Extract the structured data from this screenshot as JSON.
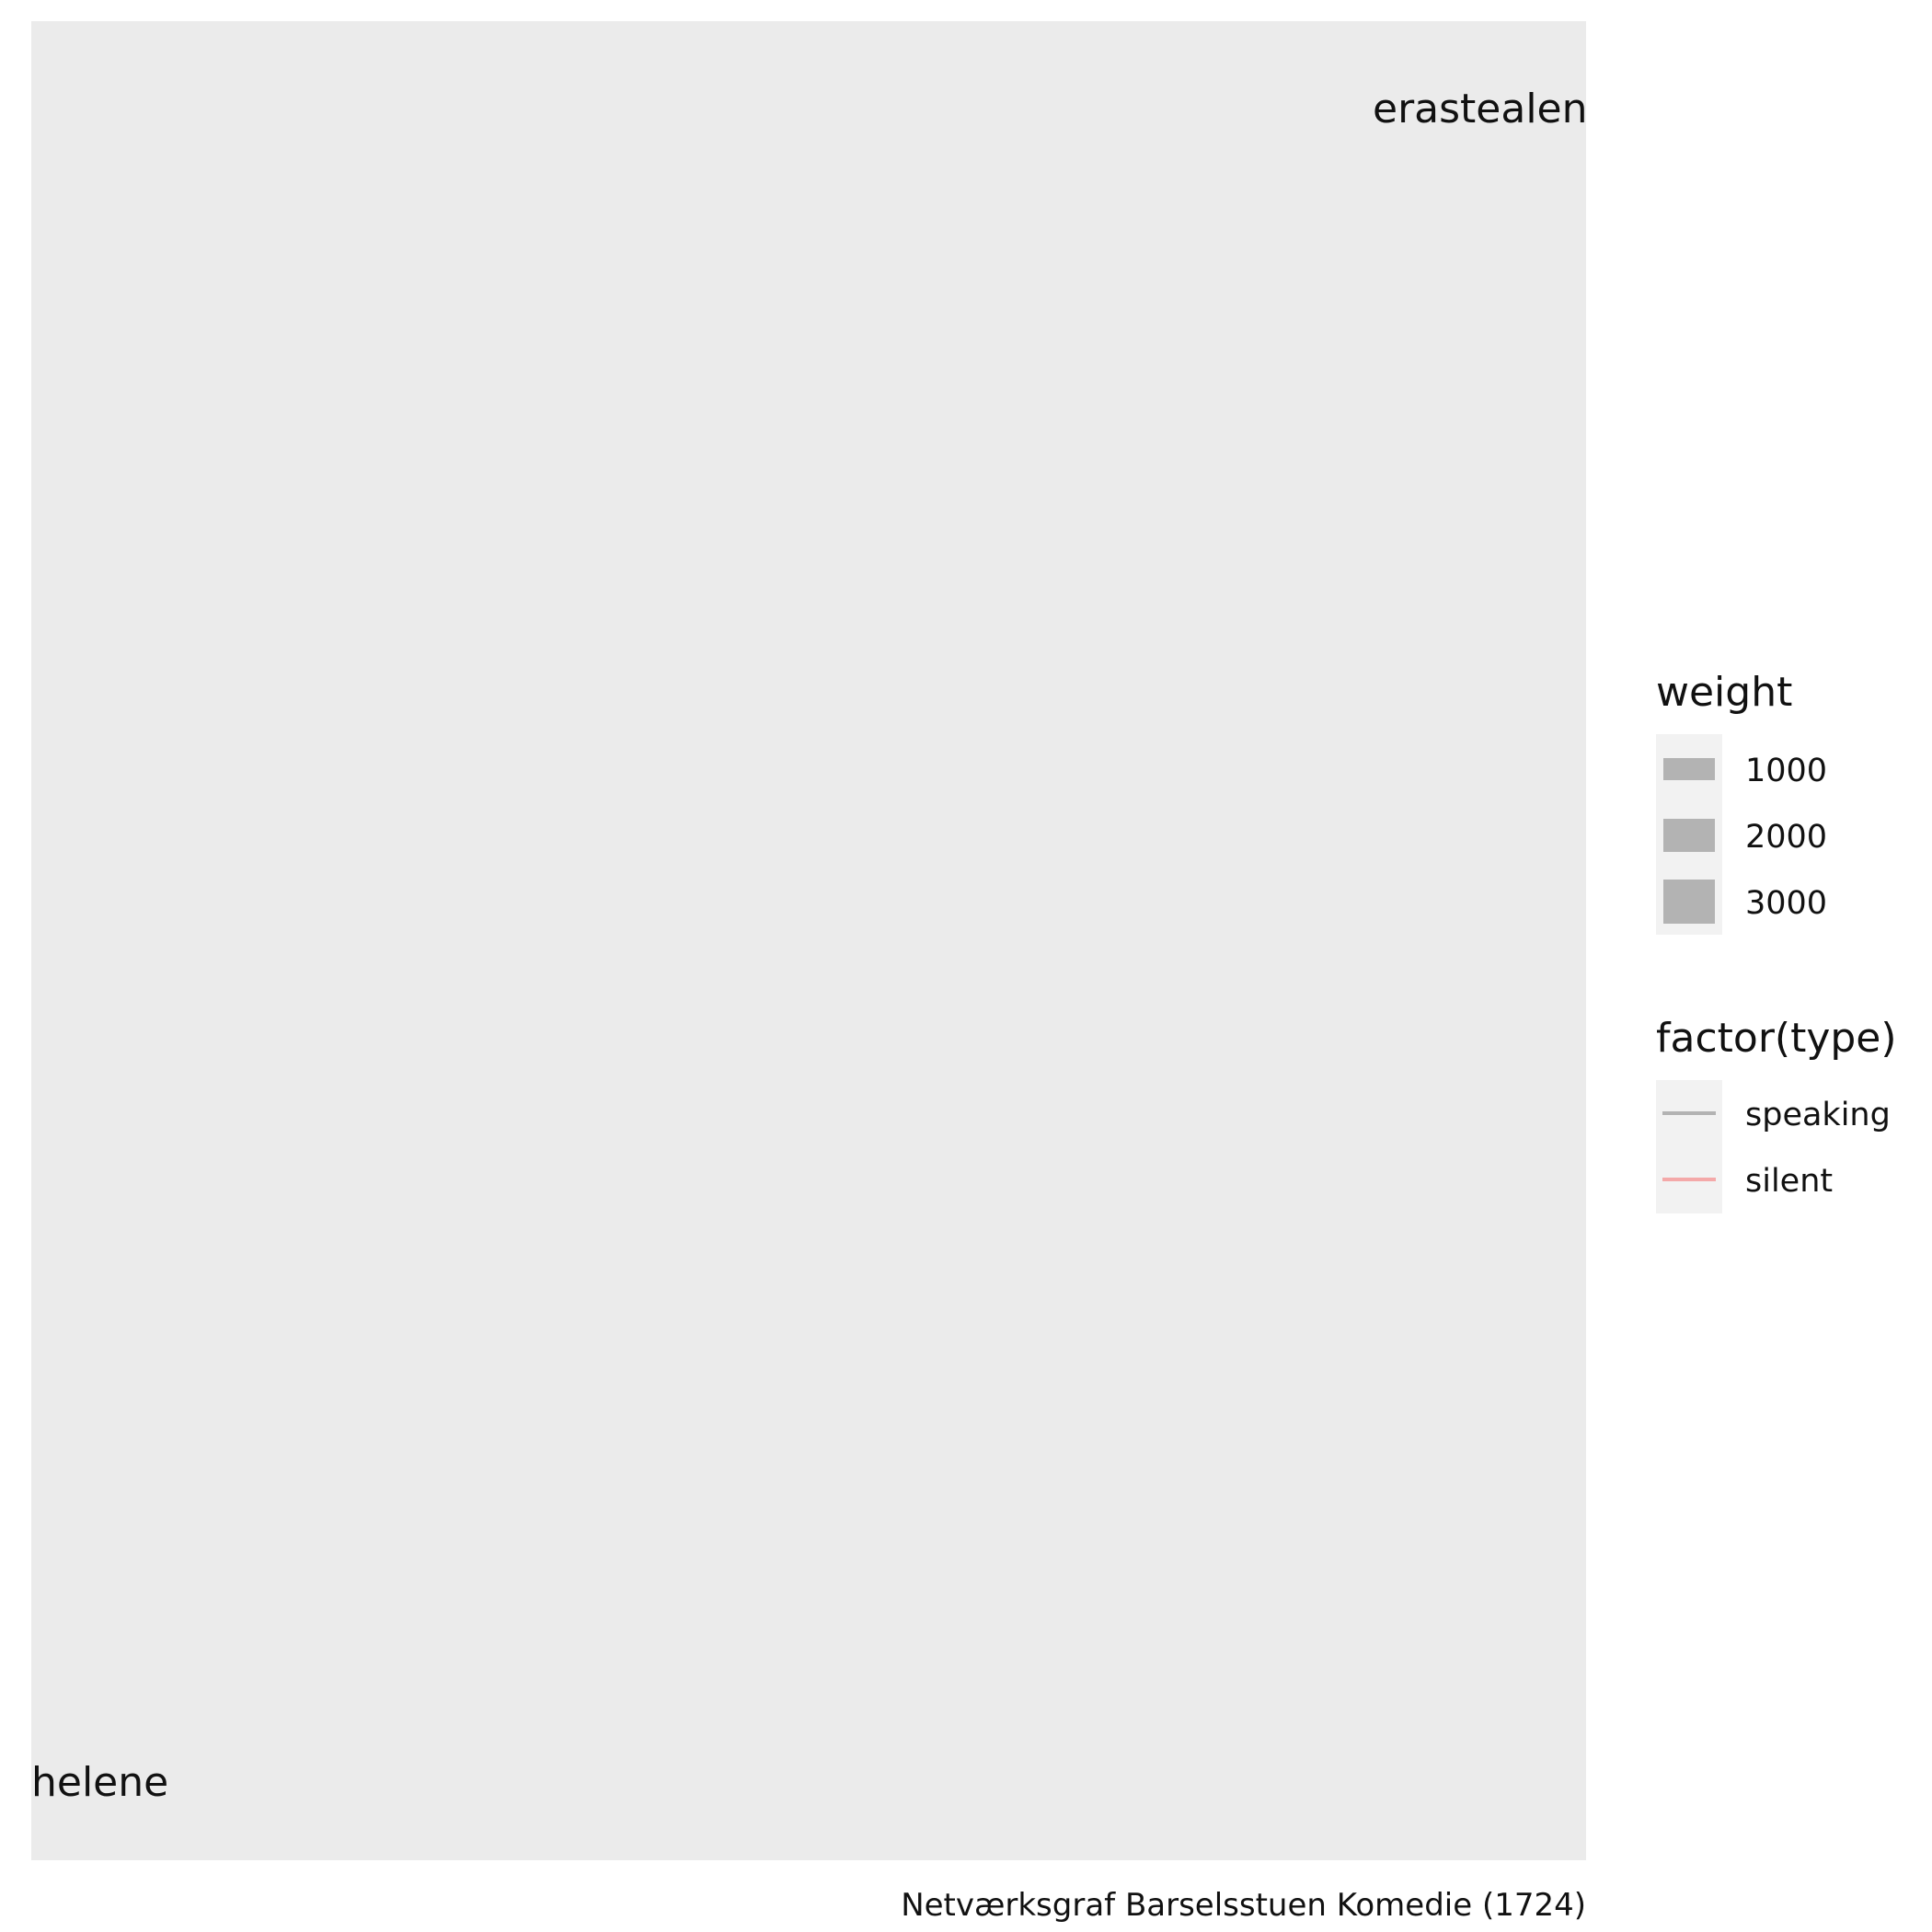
{
  "chart_data": {
    "type": "network",
    "caption": "Netværksgraf Barselsstuen Komedie (1724)",
    "nodes": [
      {
        "name": "erastealen",
        "label": "erastealen",
        "x": 1,
        "y": 1
      },
      {
        "name": "helene",
        "label": "helene",
        "x": 0,
        "y": 0
      }
    ],
    "edges": [],
    "grid": false,
    "legends": [
      {
        "title": "weight",
        "kind": "size",
        "entries": [
          {
            "label": "1000",
            "value": 1000
          },
          {
            "label": "2000",
            "value": 2000
          },
          {
            "label": "3000",
            "value": 3000
          }
        ],
        "color": "#b3b3b3"
      },
      {
        "title": "factor(type)",
        "kind": "color",
        "entries": [
          {
            "label": "speaking",
            "color": "#b3b3b3"
          },
          {
            "label": "silent",
            "color": "#f4a9a9"
          }
        ]
      }
    ],
    "legend_position": "right",
    "panel_color": "#ebebeb",
    "legend_key_background": "#f2f2f2"
  }
}
